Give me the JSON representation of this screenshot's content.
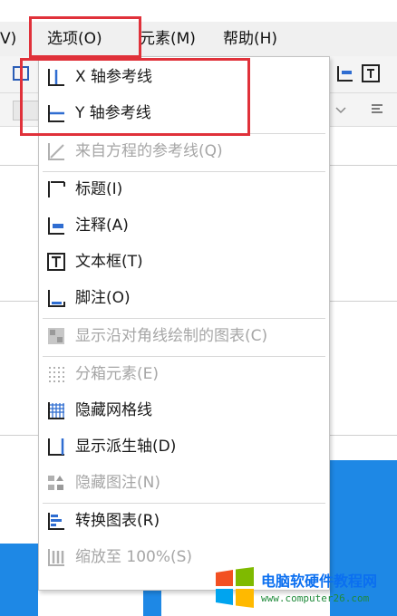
{
  "menubar": {
    "partial_left": "V)",
    "options": "选项(O)",
    "elements": "元素(M)",
    "help": "帮助(H)"
  },
  "menu": {
    "items": [
      {
        "label": "X 轴参考线",
        "icon": "x-axis-reference-line-icon",
        "enabled": true
      },
      {
        "label": "Y 轴参考线",
        "icon": "y-axis-reference-line-icon",
        "enabled": true
      },
      {
        "label": "来自方程的参考线(Q)",
        "icon": "equation-reference-line-icon",
        "enabled": false
      },
      {
        "label": "标题(I)",
        "icon": "title-icon",
        "enabled": true
      },
      {
        "label": "注释(A)",
        "icon": "annotation-icon",
        "enabled": true
      },
      {
        "label": "文本框(T)",
        "icon": "text-box-icon",
        "enabled": true
      },
      {
        "label": "脚注(O)",
        "icon": "footnote-icon",
        "enabled": true
      },
      {
        "label": "显示沿对角线绘制的图表(C)",
        "icon": "diagonal-chart-icon",
        "enabled": false
      },
      {
        "label": "分箱元素(E)",
        "icon": "binning-icon",
        "enabled": false
      },
      {
        "label": "隐藏网格线",
        "icon": "gridlines-icon",
        "enabled": true
      },
      {
        "label": "显示派生轴(D)",
        "icon": "derived-axis-icon",
        "enabled": true
      },
      {
        "label": "隐藏图注(N)",
        "icon": "legend-icon",
        "enabled": false
      },
      {
        "label": "转换图表(R)",
        "icon": "transpose-chart-icon",
        "enabled": true
      },
      {
        "label": "缩放至 100%(S)",
        "icon": "zoom-100-icon",
        "enabled": false
      }
    ]
  },
  "watermark": {
    "title": "电脑软硬件教程网",
    "url": "www.computer26.com"
  },
  "colors": {
    "highlight": "#e0313a",
    "accent": "#1e88e5",
    "disabled_text": "#a6a6a6"
  }
}
